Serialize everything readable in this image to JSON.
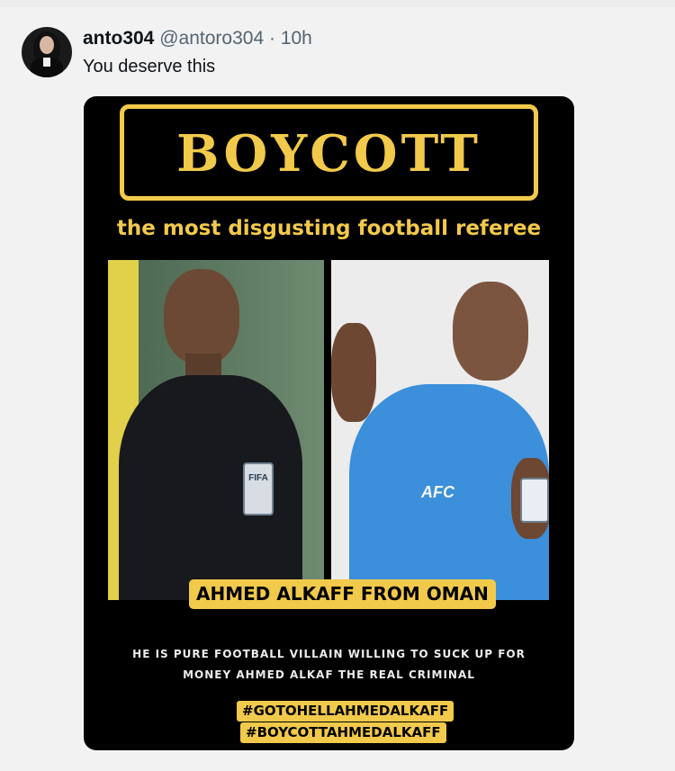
{
  "tweet": {
    "display_name": "anto304",
    "handle": "@antoro304",
    "separator": "·",
    "time": "10h",
    "text": "You deserve this"
  },
  "media": {
    "headline": "BOYCOTT",
    "subtitle": "the most disgusting football referee",
    "left_badge_text": "FIFA",
    "right_logo_text": "AFC",
    "name_label": "AHMED ALKAFF FROM OMAN",
    "caption_line1": "HE IS PURE FOOTBALL VILLAIN WILLING TO SUCK UP FOR",
    "caption_line2": "MONEY AHMED ALKAF THE REAL CRIMINAL",
    "hashtag1": "#GOTOHELLAHMEDALKAFF",
    "hashtag2": "#BOYCOTTAHMEDALKAFF"
  },
  "colors": {
    "accent_yellow": "#f1c94b",
    "media_background": "#000000",
    "page_background": "#f2f2f2"
  }
}
